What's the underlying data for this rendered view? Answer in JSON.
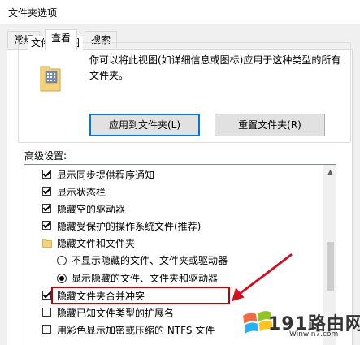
{
  "window": {
    "title": "文件夹选项"
  },
  "tabs": [
    {
      "label": "常规"
    },
    {
      "label": "查看"
    },
    {
      "label": "搜索"
    }
  ],
  "folder_views": {
    "group_label": "文件夹视图",
    "description": "你可以将此视图(如详细信息或图标)应用于这种类型的所有文件夹。",
    "apply_button": "应用到文件夹(L)",
    "reset_button": "重置文件夹(R)"
  },
  "advanced": {
    "label": "高级设置:",
    "items": [
      {
        "type": "checkbox",
        "checked": true,
        "label": "显示同步提供程序通知"
      },
      {
        "type": "checkbox",
        "checked": true,
        "label": "显示状态栏"
      },
      {
        "type": "checkbox",
        "checked": true,
        "label": "隐藏空的驱动器"
      },
      {
        "type": "checkbox",
        "checked": true,
        "label": "隐藏受保护的操作系统文件(推荐)"
      },
      {
        "type": "folder",
        "label": "隐藏文件和文件夹"
      },
      {
        "type": "radio",
        "selected": false,
        "label": "不显示隐藏的文件、文件夹或驱动器"
      },
      {
        "type": "radio",
        "selected": true,
        "label": "显示隐藏的文件、文件夹和驱动器"
      },
      {
        "type": "checkbox",
        "checked": true,
        "label": "隐藏文件夹合并冲突"
      },
      {
        "type": "checkbox",
        "checked": false,
        "label": "隐藏已知文件类型的扩展名"
      },
      {
        "type": "checkbox",
        "checked": false,
        "label": "用彩色显示加密或压缩的 NTFS 文件"
      }
    ]
  },
  "watermark": {
    "text": "191路由网",
    "url": "Winwin7.com"
  },
  "colors": {
    "highlight": "#c00000",
    "arrow": "#d01020",
    "accent": "#0078d7"
  }
}
